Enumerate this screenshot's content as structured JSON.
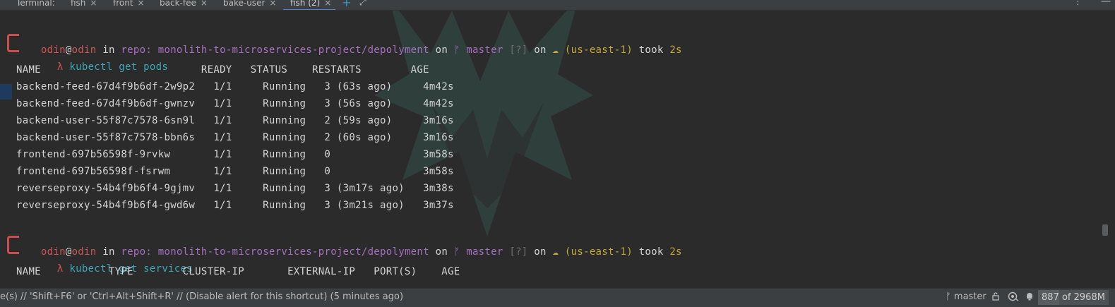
{
  "tabs": [
    {
      "label": "Terminal:",
      "close": ""
    },
    {
      "label": "fish",
      "close": "×"
    },
    {
      "label": "front",
      "close": "×"
    },
    {
      "label": "back-fee",
      "close": "×"
    },
    {
      "label": "bake-user",
      "close": "×"
    },
    {
      "label": "fish (2)",
      "close": "×"
    }
  ],
  "tabbar": {
    "add": "+",
    "maximize": "⤢",
    "menu": "⋮",
    "minimize": "—"
  },
  "prompt1": {
    "user": "odin",
    "at": "@",
    "host": "odin",
    "in": " in ",
    "repo_label": "repo:",
    "path": " monolith-to-microservices-project/depolyment",
    "on": " on ",
    "branch": "ᚠ master",
    "status": " [?]",
    "on2": " on ",
    "region": "☁ (us-east-1)",
    "took": " took ",
    "duration": "2s",
    "symbol": "λ",
    "command": " kubectl get pods"
  },
  "pods": {
    "header": "NAME                          READY   STATUS    RESTARTS        AGE",
    "rows": [
      "backend-feed-67d4f9b6df-2w9p2   1/1     Running   3 (63s ago)     4m42s",
      "backend-feed-67d4f9b6df-gwnzv   1/1     Running   3 (56s ago)     4m42s",
      "backend-user-55f87c7578-6sn9l   1/1     Running   2 (59s ago)     3m16s",
      "backend-user-55f87c7578-bbn6s   1/1     Running   2 (60s ago)     3m16s",
      "frontend-697b56598f-9rvkw       1/1     Running   0               3m58s",
      "frontend-697b56598f-fsrwm       1/1     Running   0               3m58s",
      "reverseproxy-54b4f9b6f4-9gjmv   1/1     Running   3 (3m17s ago)   3m38s",
      "reverseproxy-54b4f9b6f4-gwd6w   1/1     Running   3 (3m21s ago)   3m37s"
    ]
  },
  "prompt2": {
    "user": "odin",
    "at": "@",
    "host": "odin",
    "in": " in ",
    "repo_label": "repo:",
    "path": " monolith-to-microservices-project/depolyment",
    "on": " on ",
    "branch": "ᚠ master",
    "status": " [?]",
    "on2": " on ",
    "region": "☁ (us-east-1)",
    "took": " took ",
    "duration": "2s",
    "symbol": "λ",
    "command": " kubectl get services"
  },
  "services": {
    "header": "NAME           TYPE        CLUSTER-IP       EXTERNAL-IP   PORT(S)    AGE"
  },
  "statusbar": {
    "message": "e(s) // 'Shift+F6' or 'Ctrl+Alt+Shift+R' // (Disable alert for this shortcut) (5 minutes ago)",
    "branch": "ᚠ master",
    "memory": "887 of 2968M",
    "memory_fraction": 0.299,
    "icons": [
      "lock-icon",
      "inspector-icon",
      "notifications-icon"
    ]
  },
  "colors": {
    "background": "#2b2b2b",
    "prompt_box": "#c94f4f",
    "command": "#3aa8b8",
    "path": "#a46fbe",
    "region": "#c0a832"
  }
}
